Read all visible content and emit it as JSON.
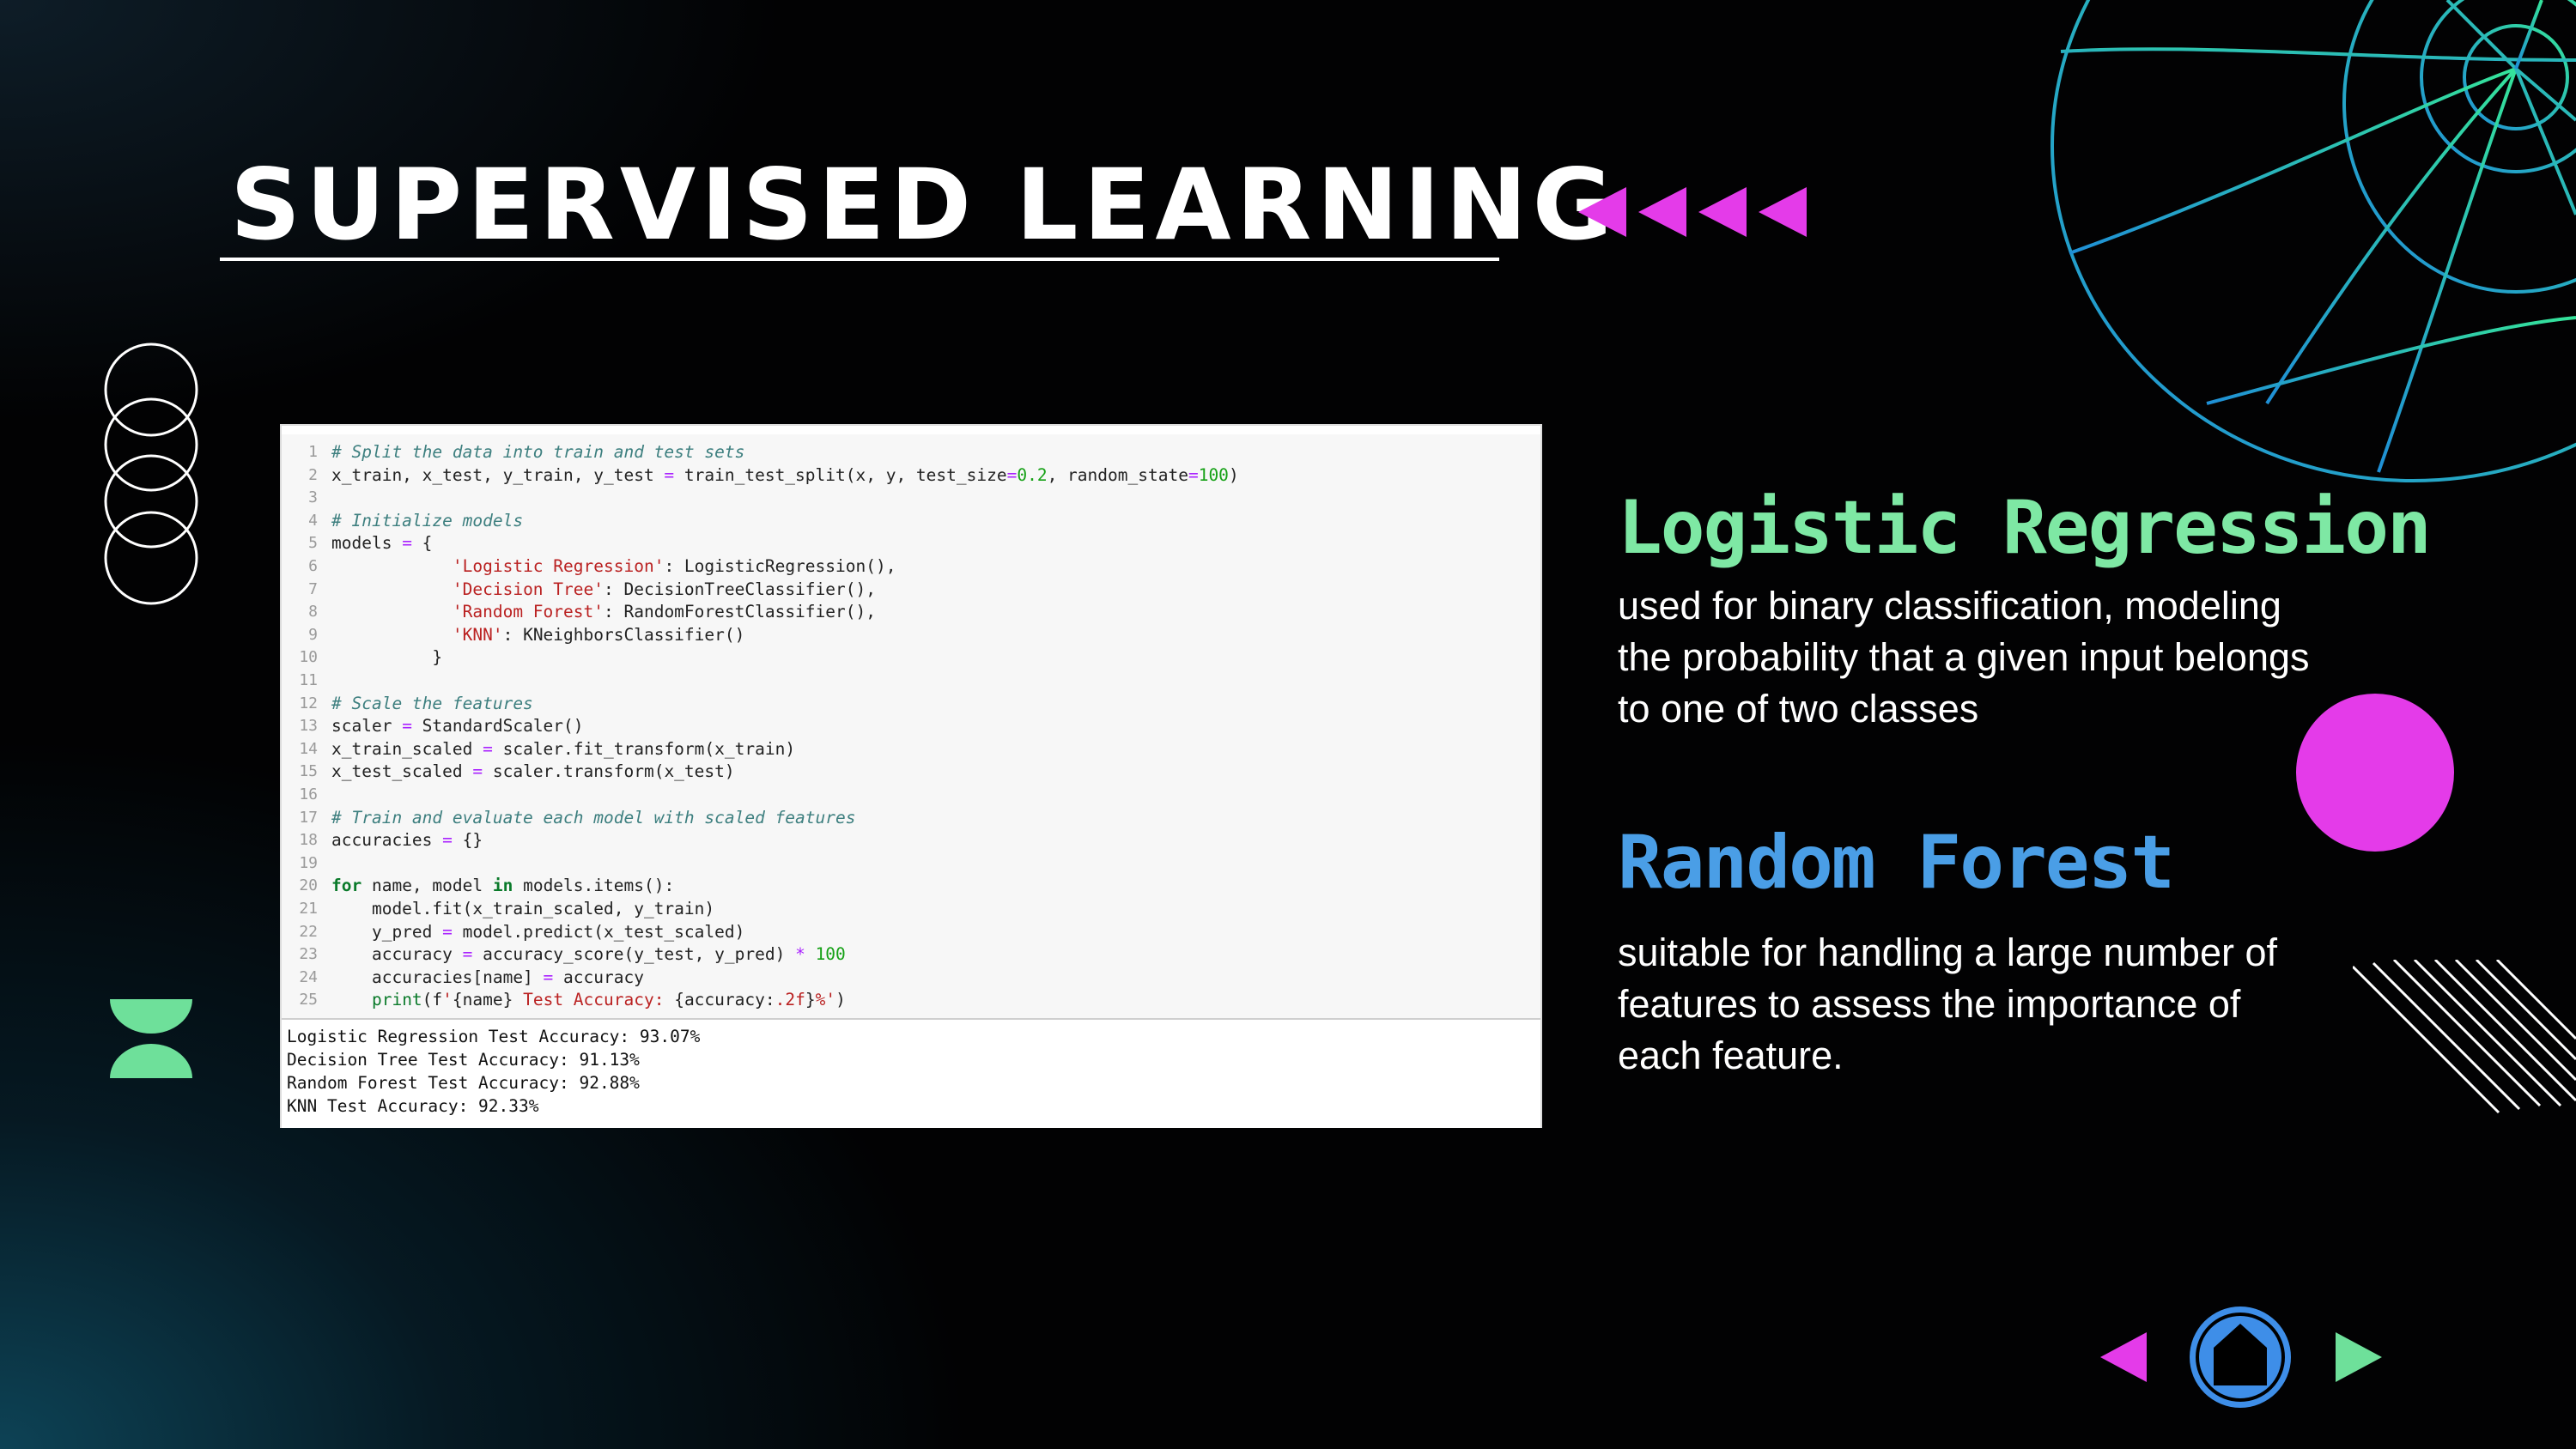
{
  "slide": {
    "title": "SUPERVISED LEARNING"
  },
  "code": {
    "lines": [
      {
        "n": "1",
        "html": "<span class=\"c-com\"># Split the data into train and test sets</span>"
      },
      {
        "n": "2",
        "html": "x_train, x_test, y_train, y_test <span class=\"c-op\">=</span> train_test_split(x, y, test_size<span class=\"c-op\">=</span><span class=\"c-num\">0.2</span>, random_state<span class=\"c-op\">=</span><span class=\"c-num\">100</span>)"
      },
      {
        "n": "3",
        "html": ""
      },
      {
        "n": "4",
        "html": "<span class=\"c-com\"># Initialize models</span>"
      },
      {
        "n": "5",
        "html": "models <span class=\"c-op\">=</span> {"
      },
      {
        "n": "6",
        "html": "            <span class=\"c-str\">'Logistic Regression'</span>: LogisticRegression(),"
      },
      {
        "n": "7",
        "html": "            <span class=\"c-str\">'Decision Tree'</span>: DecisionTreeClassifier(),"
      },
      {
        "n": "8",
        "html": "            <span class=\"c-str\">'Random Forest'</span>: RandomForestClassifier(),"
      },
      {
        "n": "9",
        "html": "            <span class=\"c-str\">'KNN'</span>: KNeighborsClassifier()"
      },
      {
        "n": "10",
        "html": "          }"
      },
      {
        "n": "11",
        "html": ""
      },
      {
        "n": "12",
        "html": "<span class=\"c-com\"># Scale the features</span>"
      },
      {
        "n": "13",
        "html": "scaler <span class=\"c-op\">=</span> StandardScaler()"
      },
      {
        "n": "14",
        "html": "x_train_scaled <span class=\"c-op\">=</span> scaler.fit_transform(x_train)"
      },
      {
        "n": "15",
        "html": "x_test_scaled <span class=\"c-op\">=</span> scaler.transform(x_test)"
      },
      {
        "n": "16",
        "html": ""
      },
      {
        "n": "17",
        "html": "<span class=\"c-com\"># Train and evaluate each model with scaled features</span>"
      },
      {
        "n": "18",
        "html": "accuracies <span class=\"c-op\">=</span> {}"
      },
      {
        "n": "19",
        "html": ""
      },
      {
        "n": "20",
        "html": "<span class=\"c-kw\">for</span> name, model <span class=\"c-kw\">in</span> models.items():"
      },
      {
        "n": "21",
        "html": "    model.fit(x_train_scaled, y_train)"
      },
      {
        "n": "22",
        "html": "    y_pred <span class=\"c-op\">=</span> model.predict(x_test_scaled)"
      },
      {
        "n": "23",
        "html": "    accuracy <span class=\"c-op\">=</span> accuracy_score(y_test, y_pred) <span class=\"c-op\">*</span> <span class=\"c-num\">100</span>"
      },
      {
        "n": "24",
        "html": "    accuracies[name] <span class=\"c-op\">=</span> accuracy"
      },
      {
        "n": "25",
        "html": "    <span class=\"c-bi\">print</span>(f<span class=\"c-str\">'</span>{name}<span class=\"c-str\"> Test Accuracy: </span>{accuracy:<span class=\"c-str\">.2f</span>}<span class=\"c-str\">%'</span>)"
      }
    ],
    "output": [
      "Logistic Regression Test Accuracy: 93.07%",
      "Decision Tree Test Accuracy: 91.13%",
      "Random Forest Test Accuracy: 92.88%",
      "KNN Test Accuracy: 92.33%"
    ]
  },
  "logistic_regression": {
    "title": "Logistic Regression",
    "description": "used for binary classification, modeling the probability that a given input belongs to one of two classes"
  },
  "random_forest": {
    "title": "Random Forest",
    "description": "suitable for handling a large number of features to assess the importance of each feature."
  },
  "colors": {
    "accent_green": "#7ee8a4",
    "accent_blue": "#4a9ee6",
    "accent_magenta": "#e43be9",
    "background": "#020203"
  },
  "icons": {
    "title_arrows": "rewind-arrows-icon",
    "left_circles": "stacked-circles-icon",
    "green_deco": "half-circles-icon",
    "globe": "globe-wireframe-icon",
    "hatch": "diagonal-lines-icon",
    "prev": "triangle-left-icon",
    "home": "home-icon",
    "next": "triangle-right-icon"
  }
}
